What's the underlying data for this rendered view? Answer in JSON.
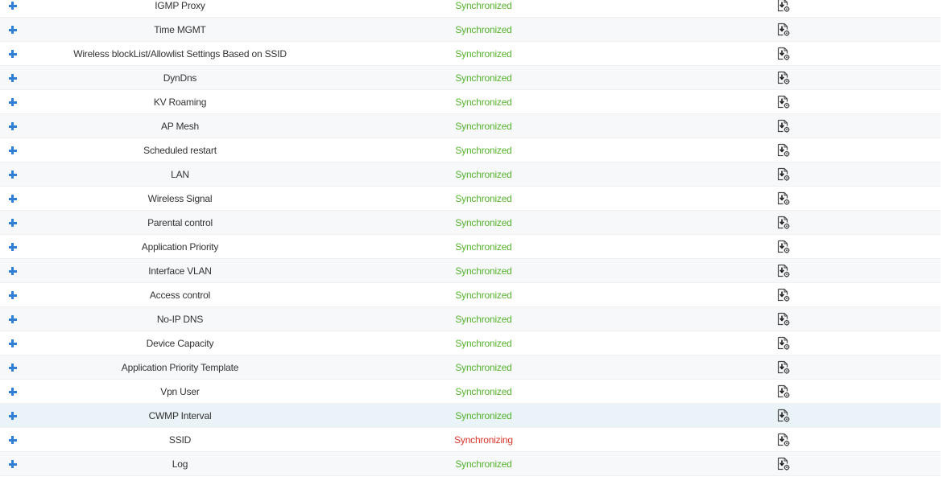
{
  "colors": {
    "synchronized": "#55b22c",
    "synchronizing": "#d9352a",
    "expand_icon": "#2f7fd6",
    "highlight_row": "#e9f3f8"
  },
  "rows": [
    {
      "name": "IGMP Proxy",
      "status": "Synchronized",
      "state": "ok",
      "icon": "sync-config-icon"
    },
    {
      "name": "Time MGMT",
      "status": "Synchronized",
      "state": "ok",
      "icon": "sync-config-icon"
    },
    {
      "name": "Wireless blockList/Allowlist Settings Based on SSID",
      "status": "Synchronized",
      "state": "ok",
      "icon": "sync-config-icon"
    },
    {
      "name": "DynDns",
      "status": "Synchronized",
      "state": "ok",
      "icon": "sync-config-icon"
    },
    {
      "name": "KV Roaming",
      "status": "Synchronized",
      "state": "ok",
      "icon": "sync-config-icon"
    },
    {
      "name": "AP Mesh",
      "status": "Synchronized",
      "state": "ok",
      "icon": "sync-config-icon"
    },
    {
      "name": "Scheduled restart",
      "status": "Synchronized",
      "state": "ok",
      "icon": "sync-config-icon"
    },
    {
      "name": "LAN",
      "status": "Synchronized",
      "state": "ok",
      "icon": "sync-config-icon"
    },
    {
      "name": "Wireless Signal",
      "status": "Synchronized",
      "state": "ok",
      "icon": "sync-config-icon"
    },
    {
      "name": "Parental control",
      "status": "Synchronized",
      "state": "ok",
      "icon": "sync-config-icon"
    },
    {
      "name": "Application Priority",
      "status": "Synchronized",
      "state": "ok",
      "icon": "sync-config-icon"
    },
    {
      "name": "Interface VLAN",
      "status": "Synchronized",
      "state": "ok",
      "icon": "sync-config-icon"
    },
    {
      "name": "Access control",
      "status": "Synchronized",
      "state": "ok",
      "icon": "sync-config-icon"
    },
    {
      "name": "No-IP DNS",
      "status": "Synchronized",
      "state": "ok",
      "icon": "sync-config-icon"
    },
    {
      "name": "Device Capacity",
      "status": "Synchronized",
      "state": "ok",
      "icon": "sync-config-icon"
    },
    {
      "name": "Application Priority Template",
      "status": "Synchronized",
      "state": "ok",
      "icon": "sync-config-icon"
    },
    {
      "name": "Vpn User",
      "status": "Synchronized",
      "state": "ok",
      "icon": "sync-config-icon"
    },
    {
      "name": "CWMP Interval",
      "status": "Synchronized",
      "state": "ok",
      "icon": "sync-config-icon",
      "highlighted": true
    },
    {
      "name": "SSID",
      "status": "Synchronizing",
      "state": "pending",
      "icon": "sync-config-icon"
    },
    {
      "name": "Log",
      "status": "Synchronized",
      "state": "ok",
      "icon": "sync-config-icon"
    }
  ]
}
